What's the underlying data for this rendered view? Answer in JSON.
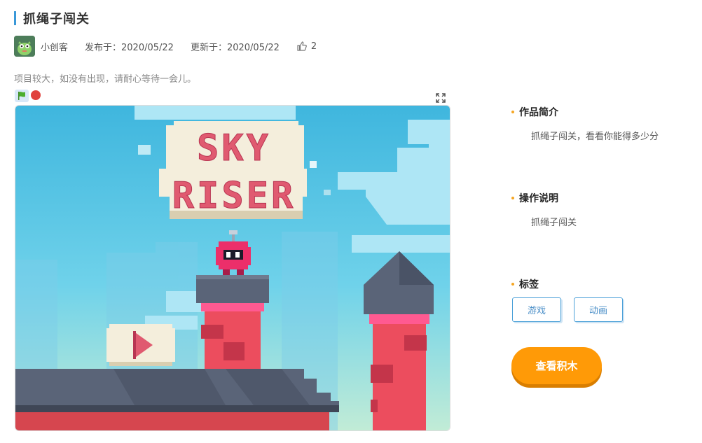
{
  "project": {
    "title": "抓绳子闯关",
    "author": "小创客",
    "published": "发布于：2020/05/22",
    "updated": "更新于：2020/05/22",
    "likes": "2",
    "notice": "项目较大，如没有出现，请耐心等待一会儿。"
  },
  "game": {
    "title_line1": "SKY",
    "title_line2": "RISER"
  },
  "sidebar": {
    "intro_title": "作品简介",
    "intro_text": "抓绳子闯关，看看你能得多少分",
    "howto_title": "操作说明",
    "howto_text": "抓绳子闯关",
    "tags_title": "标签",
    "tags": [
      "游戏",
      "动画"
    ],
    "view_button": "查看积木"
  },
  "colors": {
    "accent": "#ff9a07",
    "title_bar": "#3a98d8",
    "tag_border": "#4ba0d8"
  }
}
